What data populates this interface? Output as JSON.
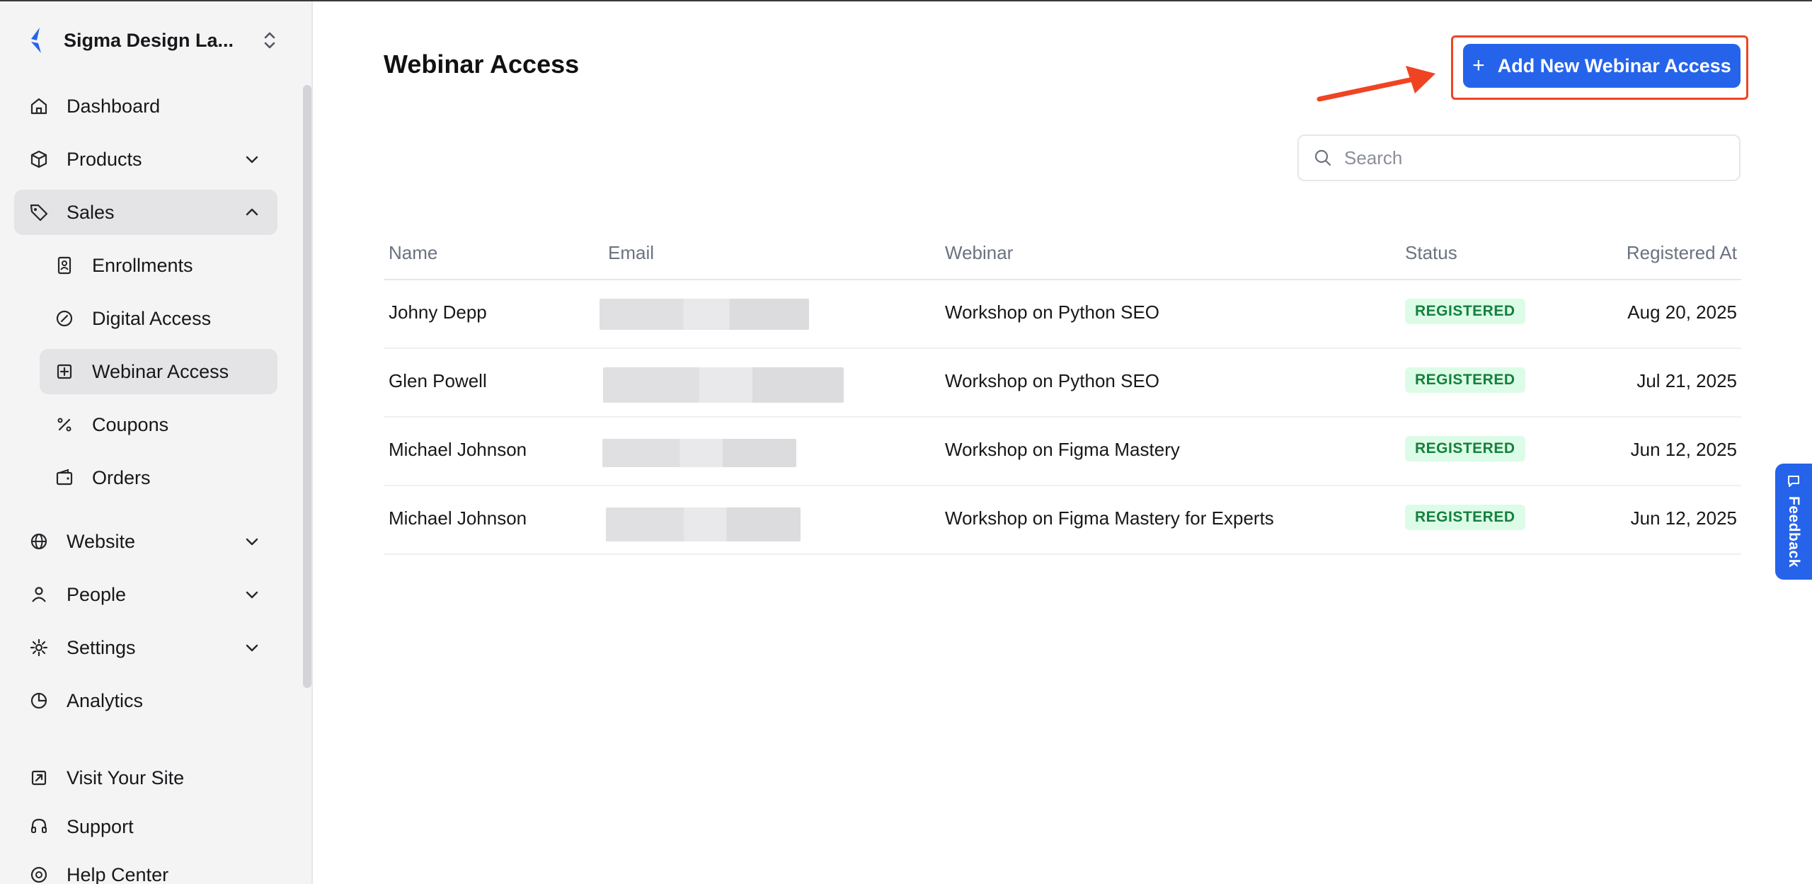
{
  "sidebar": {
    "brand_name": "Sigma Design La...",
    "items": {
      "dashboard": "Dashboard",
      "products": "Products",
      "sales": "Sales",
      "enrollments": "Enrollments",
      "digital_access": "Digital Access",
      "webinar_access": "Webinar Access",
      "coupons": "Coupons",
      "orders": "Orders",
      "website": "Website",
      "people": "People",
      "settings": "Settings",
      "analytics": "Analytics",
      "visit_site": "Visit Your Site",
      "support": "Support",
      "help_center": "Help Center"
    }
  },
  "main": {
    "title": "Webinar Access",
    "add_button": "Add New Webinar Access",
    "search_placeholder": "Search",
    "columns": {
      "name": "Name",
      "email": "Email",
      "webinar": "Webinar",
      "status": "Status",
      "registered_at": "Registered At"
    },
    "rows": [
      {
        "name": "Johny Depp",
        "webinar": "Workshop on Python SEO",
        "status": "REGISTERED",
        "date": "Aug 20, 2025"
      },
      {
        "name": "Glen Powell",
        "webinar": "Workshop on Python SEO",
        "status": "REGISTERED",
        "date": "Jul 21, 2025"
      },
      {
        "name": "Michael Johnson",
        "webinar": "Workshop on Figma Mastery",
        "status": "REGISTERED",
        "date": "Jun 12, 2025"
      },
      {
        "name": "Michael Johnson",
        "webinar": "Workshop on Figma Mastery for Experts",
        "status": "REGISTERED",
        "date": "Jun 12, 2025"
      }
    ]
  },
  "feedback_label": "Feedback",
  "colors": {
    "accent": "#2563eb",
    "highlight": "#ef4423",
    "badge_bg": "#dcfce7",
    "badge_text": "#15803d"
  }
}
